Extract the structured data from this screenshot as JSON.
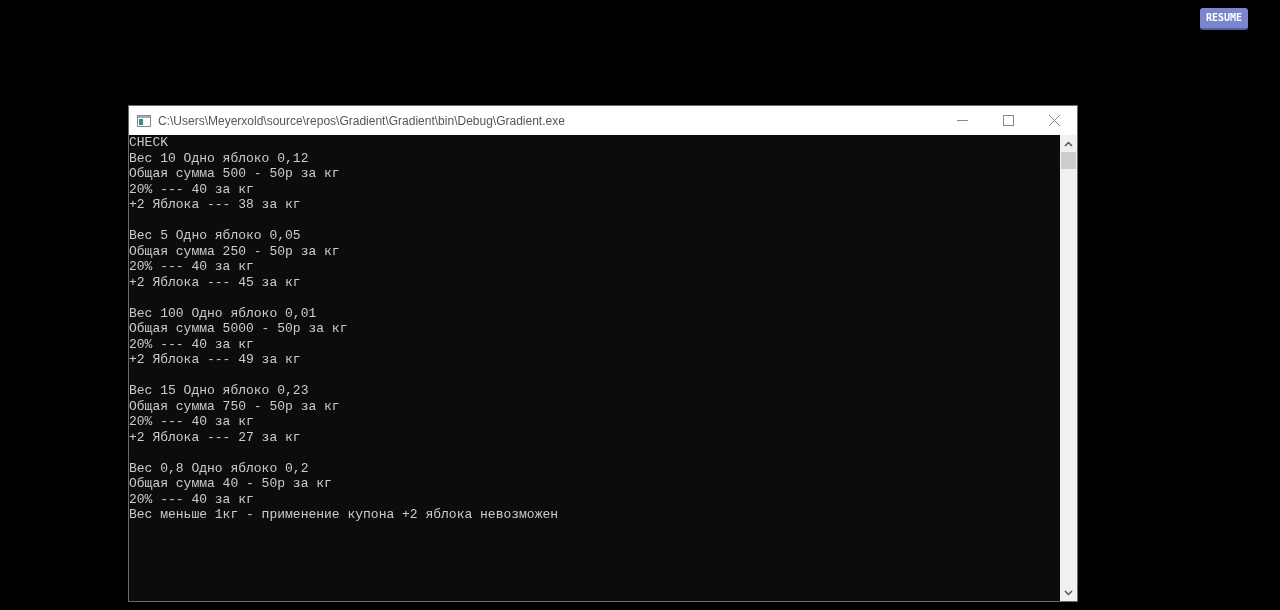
{
  "resume_button": {
    "label": "RESUME"
  },
  "window": {
    "title": "C:\\Users\\Meyerxold\\source\\repos\\Gradient\\Gradient\\bin\\Debug\\Gradient.exe"
  },
  "console": {
    "header": "CHECK",
    "blocks": [
      [
        "Вес 10 Одно яблоко 0,12",
        "Общая сумма 500 - 50р за кг",
        "20% --- 40 за кг",
        "+2 Яблока --- 38 за кг"
      ],
      [
        "Вес 5 Одно яблоко 0,05",
        "Общая сумма 250 - 50р за кг",
        "20% --- 40 за кг",
        "+2 Яблока --- 45 за кг"
      ],
      [
        "Вес 100 Одно яблоко 0,01",
        "Общая сумма 5000 - 50р за кг",
        "20% --- 40 за кг",
        "+2 Яблока --- 49 за кг"
      ],
      [
        "Вес 15 Одно яблоко 0,23",
        "Общая сумма 750 - 50р за кг",
        "20% --- 40 за кг",
        "+2 Яблока --- 27 за кг"
      ],
      [
        "Вес 0,8 Одно яблоко 0,2",
        "Общая сумма 40 - 50р за кг",
        "20% --- 40 за кг",
        "Вес меньше 1кг - применение купона +2 яблока невозможен"
      ]
    ]
  }
}
